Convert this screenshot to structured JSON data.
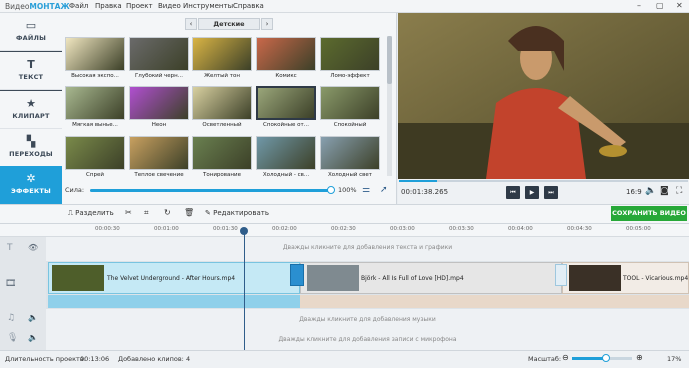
{
  "app": {
    "logo_a": "Видео",
    "logo_b": "МОНТАЖ"
  },
  "menu": [
    "Файл",
    "Правка",
    "Проект",
    "Видео",
    "Инструменты",
    "Справка"
  ],
  "sidebar": [
    {
      "label": "ФАЙЛЫ",
      "icon": "files-icon",
      "glyph": "▭"
    },
    {
      "label": "ТЕКСТ",
      "icon": "text-icon",
      "glyph": "T"
    },
    {
      "label": "КЛИПАРТ",
      "icon": "star-icon",
      "glyph": "★"
    },
    {
      "label": "ПЕРЕХОДЫ",
      "icon": "transitions-icon",
      "glyph": "▚"
    },
    {
      "label": "ЭФФЕКТЫ",
      "icon": "effects-icon",
      "glyph": "✲"
    }
  ],
  "effects": {
    "category": "Детские",
    "items": [
      {
        "label": "Высокая экспо...",
        "color": "#f0e6c0"
      },
      {
        "label": "Глубокий черн...",
        "color": "#6a6a6a"
      },
      {
        "label": "Желтый тон",
        "color": "#d9b445"
      },
      {
        "label": "Комикс",
        "color": "#c9684a"
      },
      {
        "label": "Ломо-эффект",
        "color": "#5c6b2e"
      },
      {
        "label": "Мягкая вынье...",
        "color": "#a8b890"
      },
      {
        "label": "Неон",
        "color": "#b04fd0"
      },
      {
        "label": "Осветленный",
        "color": "#d8d0a0"
      },
      {
        "label": "Спокойные от...",
        "color": "#9aa67a"
      },
      {
        "label": "Спокойный",
        "color": "#8a9a6a"
      },
      {
        "label": "Спрей",
        "color": "#7a8a4a"
      },
      {
        "label": "Теплое свечение",
        "color": "#c8a060"
      },
      {
        "label": "Тонирование",
        "color": "#6a8050"
      },
      {
        "label": "Холодный - св...",
        "color": "#7098a8"
      },
      {
        "label": "Холодный свет",
        "color": "#88a0b0"
      }
    ],
    "strength_label": "Сила:",
    "strength_pct": "100%",
    "strength_value": 1.0
  },
  "player": {
    "time": "00:01:38.265",
    "ratio": "16:9",
    "progress": 0.13
  },
  "toolbar": {
    "split": "Разделить",
    "edit": "Редактировать",
    "save": "СОХРАНИТЬ ВИДЕО"
  },
  "ruler": [
    "00:00:30",
    "00:01:00",
    "00:01:30",
    "00:02:00",
    "00:02:30",
    "00:03:00",
    "00:03:30",
    "00:04:00",
    "00:04:30",
    "00:05:00"
  ],
  "tracks": {
    "text_hint": "Дважды кликните для добавления текста и графики",
    "music_hint": "Дважды кликните для добавления музыки",
    "mic_hint": "Дважды кликните для добавления записи с микрофона",
    "clips": [
      {
        "title": "The Velvet Underground - After Hours.mp4"
      },
      {
        "title": "Björk - All Is Full of Love [HD].mp4"
      },
      {
        "title": "TOOL - Vicarious.mp4"
      }
    ]
  },
  "status": {
    "duration_label": "Длительность проекта:",
    "duration": "00:13:06",
    "clips_added": "Добавлено клипов: 4",
    "zoom_label": "Масштаб:",
    "zoom_pct": "17%",
    "zoom_value": 0.17
  }
}
